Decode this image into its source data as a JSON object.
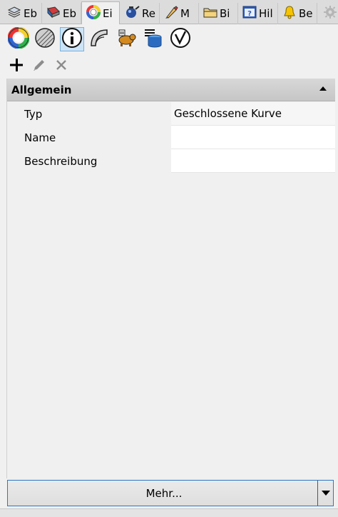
{
  "tabs": [
    {
      "label": "Eb",
      "icon": "layers-icon"
    },
    {
      "label": "Eb",
      "icon": "material-display-icon"
    },
    {
      "label": "Ei",
      "icon": "color-wheel-icon",
      "active": true
    },
    {
      "label": "Re",
      "icon": "render-teapot-icon"
    },
    {
      "label": "M",
      "icon": "material-brush-icon"
    },
    {
      "label": "Bi",
      "icon": "folder-icon"
    },
    {
      "label": "Hil",
      "icon": "help-icon"
    },
    {
      "label": "Be",
      "icon": "bell-icon"
    }
  ],
  "settings_icon": "gear-icon",
  "icon_row": [
    {
      "icon": "color-wheel-icon"
    },
    {
      "icon": "hatch-sphere-icon"
    },
    {
      "icon": "info-icon",
      "active": true
    },
    {
      "icon": "curve-surface-icon"
    },
    {
      "icon": "animal-render-icon"
    },
    {
      "icon": "document-list-icon"
    },
    {
      "icon": "database-cylinder-icon"
    },
    {
      "icon": "rhino-check-icon"
    }
  ],
  "toolbar": {
    "add_icon": "plus-icon",
    "edit_icon": "pencil-icon",
    "delete_icon": "close-icon"
  },
  "section": {
    "title": "Allgemein"
  },
  "properties": [
    {
      "key": "Typ",
      "value": "Geschlossene Kurve"
    },
    {
      "key": "Name",
      "value": ""
    },
    {
      "key": "Beschreibung",
      "value": ""
    }
  ],
  "more_button": {
    "label": "Mehr..."
  },
  "colors": {
    "accent_border": "#2a78c8",
    "active_icon_bg": "#cce4f7"
  }
}
